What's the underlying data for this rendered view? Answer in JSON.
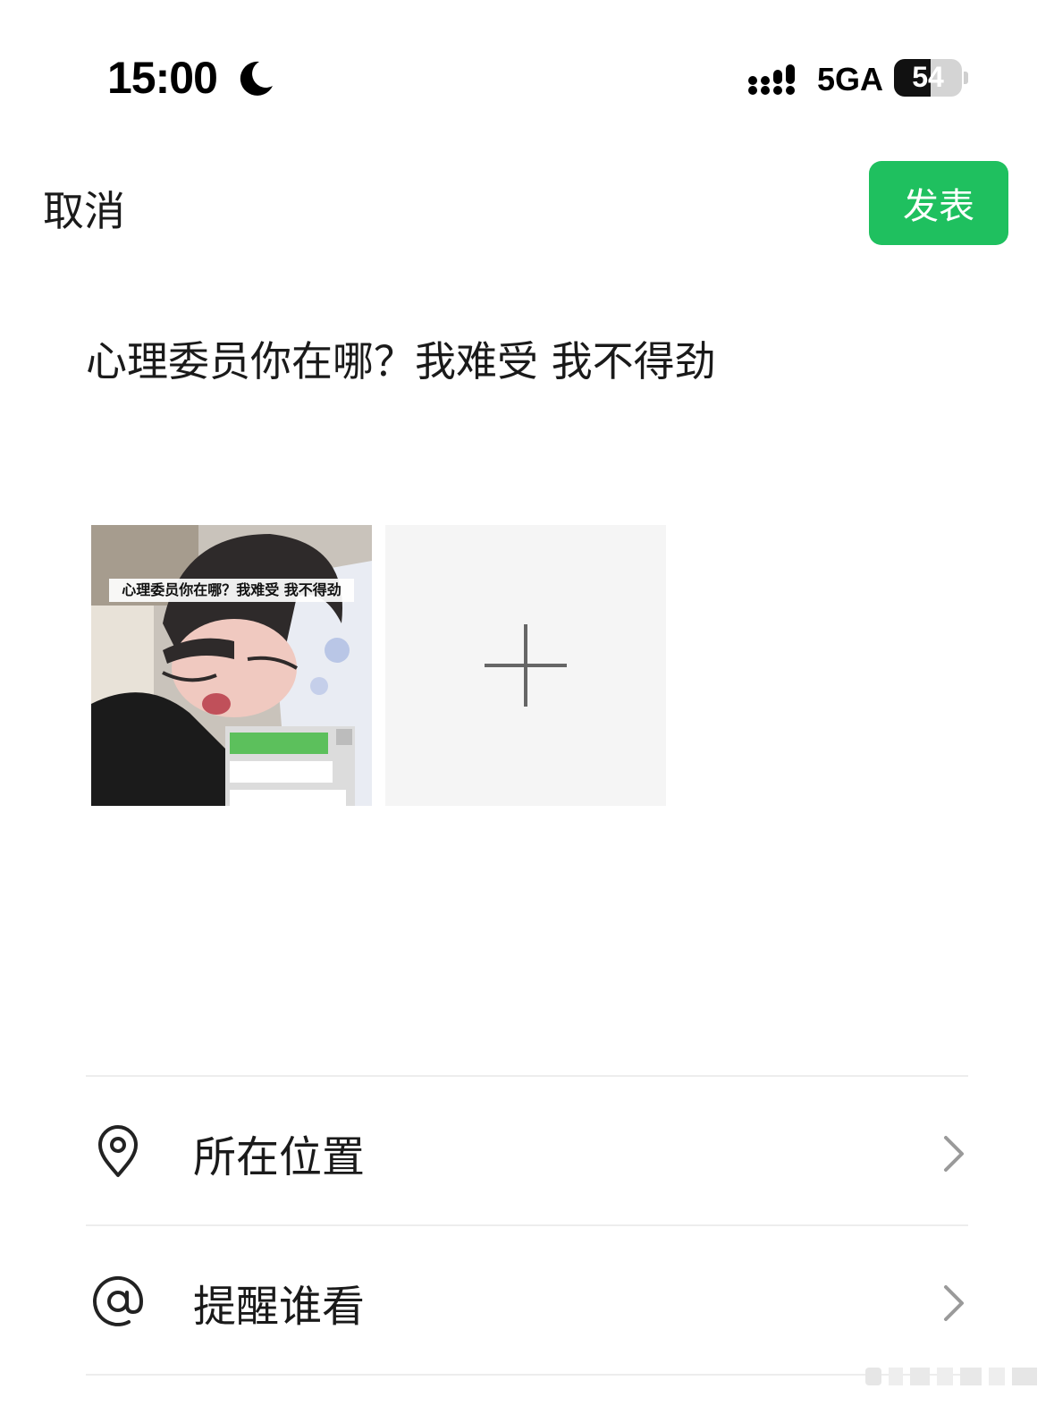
{
  "status_bar": {
    "time": "15:00",
    "network": "5GA",
    "battery": "54",
    "battery_level": 0.54,
    "icons": [
      "moon-icon",
      "signal-icon",
      "battery-icon"
    ]
  },
  "header": {
    "cancel_label": "取消",
    "publish_label": "发表",
    "accent_color": "#1fc05f"
  },
  "post": {
    "text": "心理委员你在哪？我难受 我不得劲",
    "photo_caption": "心理委员你在哪？我难受 我不得劲",
    "add_photo_icon": "plus-icon"
  },
  "options": [
    {
      "label": "所在位置",
      "icon": "location-pin-icon"
    },
    {
      "label": "提醒谁看",
      "icon": "at-sign-icon"
    }
  ]
}
